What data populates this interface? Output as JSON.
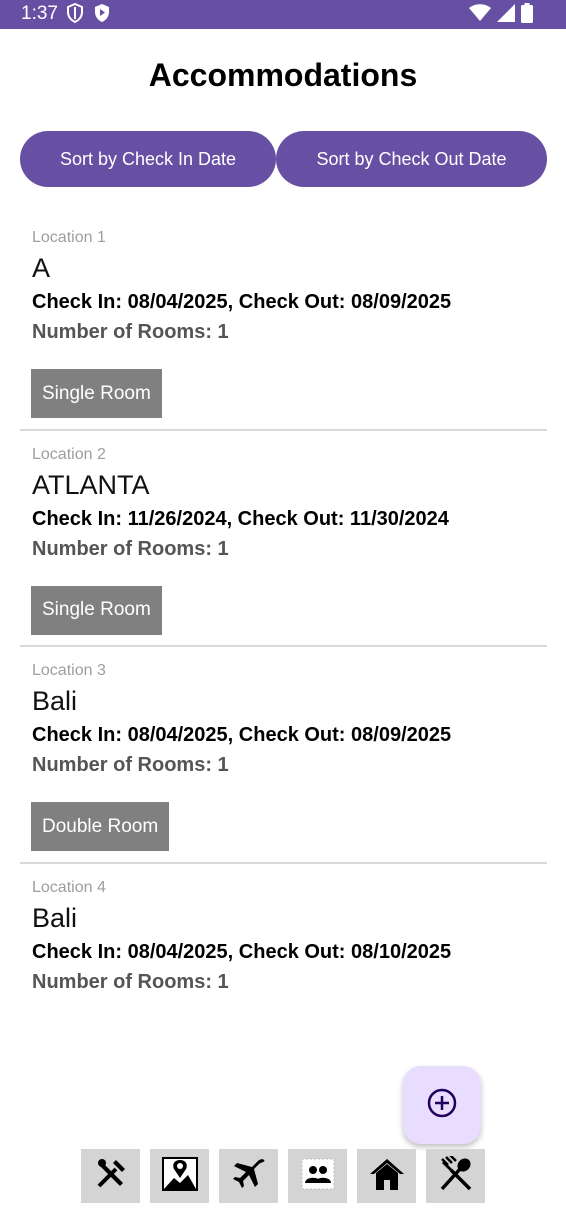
{
  "status_bar": {
    "time": "1:37",
    "left_icons": [
      "shield-icon",
      "play-protect-icon"
    ],
    "right_icons": [
      "wifi-icon",
      "signal-icon",
      "battery-icon"
    ],
    "color": "#6750a4"
  },
  "header": {
    "title": "Accommodations"
  },
  "sort_buttons": {
    "check_in_label": "Sort by Check In Date",
    "check_out_label": "Sort by Check Out Date"
  },
  "accommodations": [
    {
      "location_label": "Location 1",
      "name": "A",
      "dates": "Check In: 08/04/2025, Check Out: 08/09/2025",
      "rooms": "Number of Rooms: 1",
      "room_type": "Single Room"
    },
    {
      "location_label": "Location 2",
      "name": "ATLANTA",
      "dates": "Check In: 11/26/2024, Check Out: 11/30/2024",
      "rooms": "Number of Rooms: 1",
      "room_type": "Single Room"
    },
    {
      "location_label": "Location 3",
      "name": "Bali",
      "dates": "Check In: 08/04/2025, Check Out: 08/09/2025",
      "rooms": "Number of Rooms: 1",
      "room_type": "Double Room"
    },
    {
      "location_label": "Location 4",
      "name": "Bali",
      "dates": "Check In: 08/04/2025, Check Out: 08/10/2025",
      "rooms": "Number of Rooms: 1"
    }
  ],
  "fab": {
    "icon": "add-circle-icon",
    "background": "#e9ddff"
  },
  "bottom_nav": {
    "items": [
      {
        "icon": "tools-icon"
      },
      {
        "icon": "map-pin-icon"
      },
      {
        "icon": "airplane-icon"
      },
      {
        "icon": "people-icon"
      },
      {
        "icon": "house-icon"
      },
      {
        "icon": "fork-spoon-icon"
      }
    ]
  }
}
